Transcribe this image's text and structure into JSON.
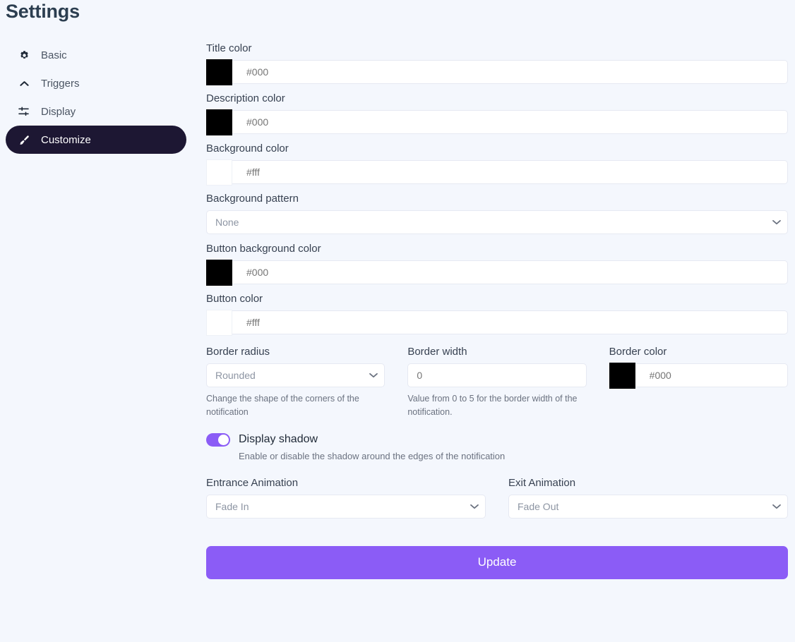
{
  "header": {
    "title": "Settings"
  },
  "theme": {
    "page_bg": "#f4f7fd",
    "accent": "#8b5cf6",
    "sidebar_active_bg": "#1d1733",
    "input_bg": "#ffffff",
    "input_border": "#e6e9f2",
    "label_color": "#374151",
    "help_color": "#6b7280"
  },
  "sidebar": {
    "items": [
      {
        "label": "Basic",
        "icon": "gear-icon",
        "active": false
      },
      {
        "label": "Triggers",
        "icon": "chevron-up-icon",
        "active": false
      },
      {
        "label": "Display",
        "icon": "sliders-icon",
        "active": false
      },
      {
        "label": "Customize",
        "icon": "paintbrush-icon",
        "active": true
      }
    ]
  },
  "form": {
    "title_color": {
      "label": "Title color",
      "swatch": "#000000",
      "placeholder": "#000",
      "value": ""
    },
    "description_color": {
      "label": "Description color",
      "swatch": "#000000",
      "placeholder": "#000",
      "value": ""
    },
    "background_color": {
      "label": "Background color",
      "swatch": "#ffffff",
      "placeholder": "#fff",
      "value": ""
    },
    "background_pattern": {
      "label": "Background pattern",
      "selected": "None",
      "options": [
        "None"
      ]
    },
    "button_background_color": {
      "label": "Button background color",
      "swatch": "#000000",
      "placeholder": "#000",
      "value": ""
    },
    "button_color": {
      "label": "Button color",
      "swatch": "#ffffff",
      "placeholder": "#fff",
      "value": ""
    },
    "border_radius": {
      "label": "Border radius",
      "selected": "Rounded",
      "options": [
        "Rounded"
      ],
      "help": "Change the shape of the corners of the notification"
    },
    "border_width": {
      "label": "Border width",
      "placeholder": "0",
      "value": "",
      "help": "Value from 0 to 5 for the border width of the notification."
    },
    "border_color": {
      "label": "Border color",
      "swatch": "#000000",
      "placeholder": "#000",
      "value": ""
    },
    "display_shadow": {
      "label": "Display shadow",
      "enabled": true,
      "help": "Enable or disable the shadow around the edges of the notification"
    },
    "entrance_animation": {
      "label": "Entrance Animation",
      "selected": "Fade In",
      "options": [
        "Fade In"
      ]
    },
    "exit_animation": {
      "label": "Exit Animation",
      "selected": "Fade Out",
      "options": [
        "Fade Out"
      ]
    },
    "submit": {
      "label": "Update"
    }
  }
}
